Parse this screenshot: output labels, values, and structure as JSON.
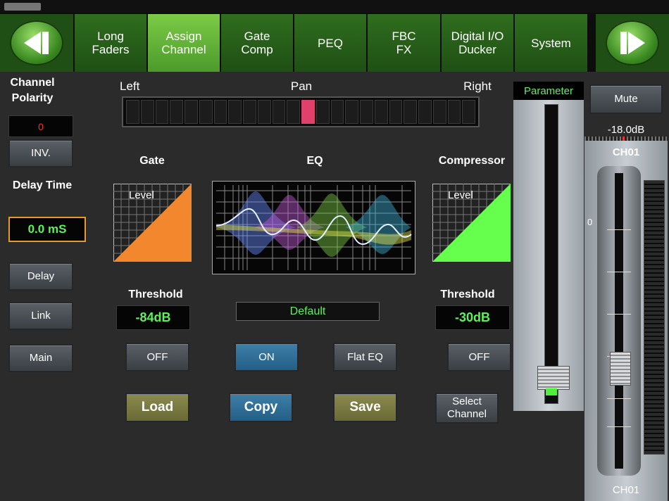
{
  "nav": {
    "tabs": [
      {
        "label": "Long\nFaders",
        "active": false
      },
      {
        "label": "Assign\nChannel",
        "active": true
      },
      {
        "label": "Gate\nComp",
        "active": false
      },
      {
        "label": "PEQ",
        "active": false
      },
      {
        "label": "FBC\nFX",
        "active": false
      },
      {
        "label": "Digital I/O\nDucker",
        "active": false
      },
      {
        "label": "System",
        "active": false
      }
    ]
  },
  "left": {
    "polarity_title": "Channel\nPolarity",
    "polarity_value": "0",
    "inv_label": "INV.",
    "delay_title": "Delay Time",
    "delay_value": "0.0 mS",
    "delay_btn": "Delay",
    "link_btn": "Link",
    "main_btn": "Main"
  },
  "pan": {
    "left": "Left",
    "title": "Pan",
    "right": "Right",
    "position_cell": 12,
    "cells": 24
  },
  "gate": {
    "title": "Gate",
    "graph_label": "Level",
    "threshold_title": "Threshold",
    "threshold_value": "-84dB",
    "toggle": "OFF"
  },
  "eq": {
    "title": "EQ",
    "preset": "Default",
    "toggle": "ON",
    "flat_btn": "Flat EQ"
  },
  "compressor": {
    "title": "Compressor",
    "graph_label": "Level",
    "threshold_title": "Threshold",
    "threshold_value": "-30dB",
    "toggle": "OFF"
  },
  "actions": {
    "load": "Load",
    "copy": "Copy",
    "save": "Save",
    "select_channel": "Select\nChannel"
  },
  "parameter": {
    "title": "Parameter"
  },
  "channel": {
    "mute": "Mute",
    "level": "-18.0dB",
    "name_top": "CH01",
    "scale_zero": "0",
    "name_bottom": "CH01"
  },
  "colors": {
    "accent_green": "#5cf25a",
    "gate": "#f2872e",
    "compressor": "#66ff4d",
    "pan_marker": "#e0406a"
  }
}
